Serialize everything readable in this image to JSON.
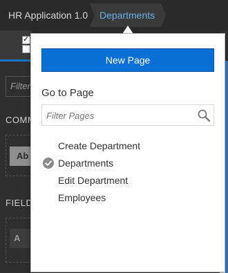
{
  "breadcrumb": {
    "app": "HR Application 1.0",
    "current": "Departments"
  },
  "sidebar": {
    "filter_placeholder": "Filter",
    "section_common": "COMM",
    "chip_common": "Ab",
    "section_fields": "FIELD",
    "chip_fields": "A"
  },
  "popup": {
    "new_page_label": "New Page",
    "goto_title": "Go to Page",
    "filter_placeholder": "Filter Pages",
    "pages": [
      {
        "label": "Create Department",
        "selected": false
      },
      {
        "label": "Departments",
        "selected": true
      },
      {
        "label": "Edit Department",
        "selected": false
      },
      {
        "label": "Employees",
        "selected": false
      }
    ]
  },
  "colors": {
    "accent": "#0a6fd6",
    "breadcrumb_active": "#6ab0e6",
    "background": "#2b2b2b"
  },
  "icons": {
    "search": "search-icon",
    "check": "check-circle-icon"
  }
}
